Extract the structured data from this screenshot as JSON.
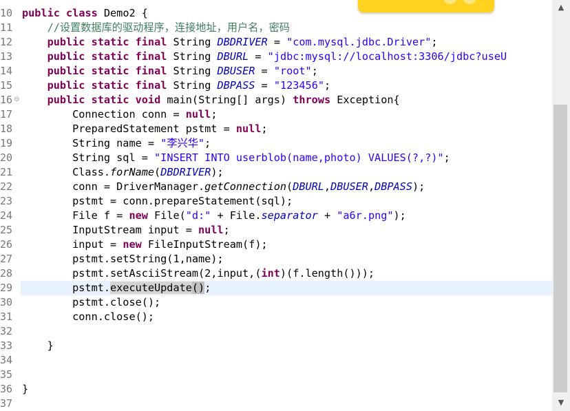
{
  "editor": {
    "current_line": "29",
    "lines": [
      {
        "num": "10",
        "tokens": [
          {
            "t": "kw",
            "v": "public"
          },
          {
            "t": "",
            "v": " "
          },
          {
            "t": "kw",
            "v": "class"
          },
          {
            "t": "",
            "v": " Demo2 {"
          }
        ]
      },
      {
        "num": "11",
        "tokens": [
          {
            "t": "",
            "v": "    "
          },
          {
            "t": "cm",
            "v": "//设置数据库的驱动程序，连接地址，用户名，密码"
          }
        ]
      },
      {
        "num": "12",
        "tokens": [
          {
            "t": "",
            "v": "    "
          },
          {
            "t": "kw",
            "v": "public"
          },
          {
            "t": "",
            "v": " "
          },
          {
            "t": "kw",
            "v": "static"
          },
          {
            "t": "",
            "v": " "
          },
          {
            "t": "kw",
            "v": "final"
          },
          {
            "t": "",
            "v": " String "
          },
          {
            "t": "fld",
            "v": "DBDRIVER"
          },
          {
            "t": "",
            "v": " = "
          },
          {
            "t": "str",
            "v": "\"com.mysql.jdbc.Driver\""
          },
          {
            "t": "",
            "v": ";"
          }
        ]
      },
      {
        "num": "13",
        "tokens": [
          {
            "t": "",
            "v": "    "
          },
          {
            "t": "kw",
            "v": "public"
          },
          {
            "t": "",
            "v": " "
          },
          {
            "t": "kw",
            "v": "static"
          },
          {
            "t": "",
            "v": " "
          },
          {
            "t": "kw",
            "v": "final"
          },
          {
            "t": "",
            "v": " String "
          },
          {
            "t": "fld",
            "v": "DBURL"
          },
          {
            "t": "",
            "v": " = "
          },
          {
            "t": "str",
            "v": "\"jdbc:mysql://localhost:3306/jdbc?useU"
          }
        ]
      },
      {
        "num": "14",
        "tokens": [
          {
            "t": "",
            "v": "    "
          },
          {
            "t": "kw",
            "v": "public"
          },
          {
            "t": "",
            "v": " "
          },
          {
            "t": "kw",
            "v": "static"
          },
          {
            "t": "",
            "v": " "
          },
          {
            "t": "kw",
            "v": "final"
          },
          {
            "t": "",
            "v": " String "
          },
          {
            "t": "fld",
            "v": "DBUSER"
          },
          {
            "t": "",
            "v": " = "
          },
          {
            "t": "str",
            "v": "\"root\""
          },
          {
            "t": "",
            "v": ";"
          }
        ]
      },
      {
        "num": "15",
        "tokens": [
          {
            "t": "",
            "v": "    "
          },
          {
            "t": "kw",
            "v": "public"
          },
          {
            "t": "",
            "v": " "
          },
          {
            "t": "kw",
            "v": "static"
          },
          {
            "t": "",
            "v": " "
          },
          {
            "t": "kw",
            "v": "final"
          },
          {
            "t": "",
            "v": " String "
          },
          {
            "t": "fld",
            "v": "DBPASS"
          },
          {
            "t": "",
            "v": " = "
          },
          {
            "t": "str",
            "v": "\"123456\""
          },
          {
            "t": "",
            "v": ";"
          }
        ]
      },
      {
        "num": "16",
        "fold": true,
        "tokens": [
          {
            "t": "",
            "v": "    "
          },
          {
            "t": "kw",
            "v": "public"
          },
          {
            "t": "",
            "v": " "
          },
          {
            "t": "kw",
            "v": "static"
          },
          {
            "t": "",
            "v": " "
          },
          {
            "t": "kw",
            "v": "void"
          },
          {
            "t": "",
            "v": " main(String[] args) "
          },
          {
            "t": "kw",
            "v": "throws"
          },
          {
            "t": "",
            "v": " Exception{"
          }
        ]
      },
      {
        "num": "17",
        "tokens": [
          {
            "t": "",
            "v": "        Connection conn = "
          },
          {
            "t": "kw",
            "v": "null"
          },
          {
            "t": "",
            "v": ";"
          }
        ]
      },
      {
        "num": "18",
        "tokens": [
          {
            "t": "",
            "v": "        PreparedStatement pstmt = "
          },
          {
            "t": "kw",
            "v": "null"
          },
          {
            "t": "",
            "v": ";"
          }
        ]
      },
      {
        "num": "19",
        "tokens": [
          {
            "t": "",
            "v": "        String name = "
          },
          {
            "t": "str",
            "v": "\"李兴华\""
          },
          {
            "t": "",
            "v": ";"
          }
        ]
      },
      {
        "num": "20",
        "tokens": [
          {
            "t": "",
            "v": "        String sql = "
          },
          {
            "t": "str",
            "v": "\"INSERT INTO userblob(name,photo) VALUES(?,?)\""
          },
          {
            "t": "",
            "v": ";"
          }
        ]
      },
      {
        "num": "21",
        "tokens": [
          {
            "t": "",
            "v": "        Class."
          },
          {
            "t": "sm",
            "v": "forName"
          },
          {
            "t": "",
            "v": "("
          },
          {
            "t": "fld",
            "v": "DBDRIVER"
          },
          {
            "t": "",
            "v": ");"
          }
        ]
      },
      {
        "num": "22",
        "tokens": [
          {
            "t": "",
            "v": "        conn = DriverManager."
          },
          {
            "t": "sm",
            "v": "getConnection"
          },
          {
            "t": "",
            "v": "("
          },
          {
            "t": "fld",
            "v": "DBURL"
          },
          {
            "t": "",
            "v": ","
          },
          {
            "t": "fld",
            "v": "DBUSER"
          },
          {
            "t": "",
            "v": ","
          },
          {
            "t": "fld",
            "v": "DBPASS"
          },
          {
            "t": "",
            "v": ");"
          }
        ]
      },
      {
        "num": "23",
        "tokens": [
          {
            "t": "",
            "v": "        pstmt = conn.prepareStatement(sql);"
          }
        ]
      },
      {
        "num": "24",
        "tokens": [
          {
            "t": "",
            "v": "        File f = "
          },
          {
            "t": "kw",
            "v": "new"
          },
          {
            "t": "",
            "v": " File("
          },
          {
            "t": "str",
            "v": "\"d:\""
          },
          {
            "t": "",
            "v": " + File."
          },
          {
            "t": "fld",
            "v": "separator"
          },
          {
            "t": "",
            "v": " + "
          },
          {
            "t": "str",
            "v": "\"a6r.png\""
          },
          {
            "t": "",
            "v": ");"
          }
        ]
      },
      {
        "num": "25",
        "tokens": [
          {
            "t": "",
            "v": "        InputStream input = "
          },
          {
            "t": "kw",
            "v": "null"
          },
          {
            "t": "",
            "v": ";"
          }
        ]
      },
      {
        "num": "26",
        "tokens": [
          {
            "t": "",
            "v": "        input = "
          },
          {
            "t": "kw",
            "v": "new"
          },
          {
            "t": "",
            "v": " FileInputStream(f);"
          }
        ]
      },
      {
        "num": "27",
        "tokens": [
          {
            "t": "",
            "v": "        pstmt.setString(1,name);"
          }
        ]
      },
      {
        "num": "28",
        "tokens": [
          {
            "t": "",
            "v": "        pstmt.setAsciiStream(2,input,("
          },
          {
            "t": "kw",
            "v": "int"
          },
          {
            "t": "",
            "v": ")(f.length()));"
          }
        ]
      },
      {
        "num": "29",
        "tokens": [
          {
            "t": "",
            "v": "        pstmt."
          },
          {
            "t": "sel",
            "v": "executeUpdate"
          },
          {
            "t": "bm",
            "v": "()"
          },
          {
            "t": "",
            "v": ";"
          }
        ]
      },
      {
        "num": "30",
        "tokens": [
          {
            "t": "",
            "v": "        pstmt.close();"
          }
        ]
      },
      {
        "num": "31",
        "tokens": [
          {
            "t": "",
            "v": "        conn.close();"
          }
        ]
      },
      {
        "num": "32",
        "tokens": []
      },
      {
        "num": "33",
        "tokens": [
          {
            "t": "",
            "v": "    }"
          }
        ]
      },
      {
        "num": "34",
        "tokens": []
      },
      {
        "num": "35",
        "tokens": []
      },
      {
        "num": "36",
        "tokens": [
          {
            "t": "",
            "v": "}"
          }
        ]
      },
      {
        "num": "37",
        "tokens": []
      }
    ]
  },
  "scrollbar": {
    "up_icon": "chevron-up-icon",
    "down_icon": "chevron-down-icon",
    "up_glyph": "▲",
    "down_glyph": "▼"
  },
  "fold_glyph": "⊖"
}
